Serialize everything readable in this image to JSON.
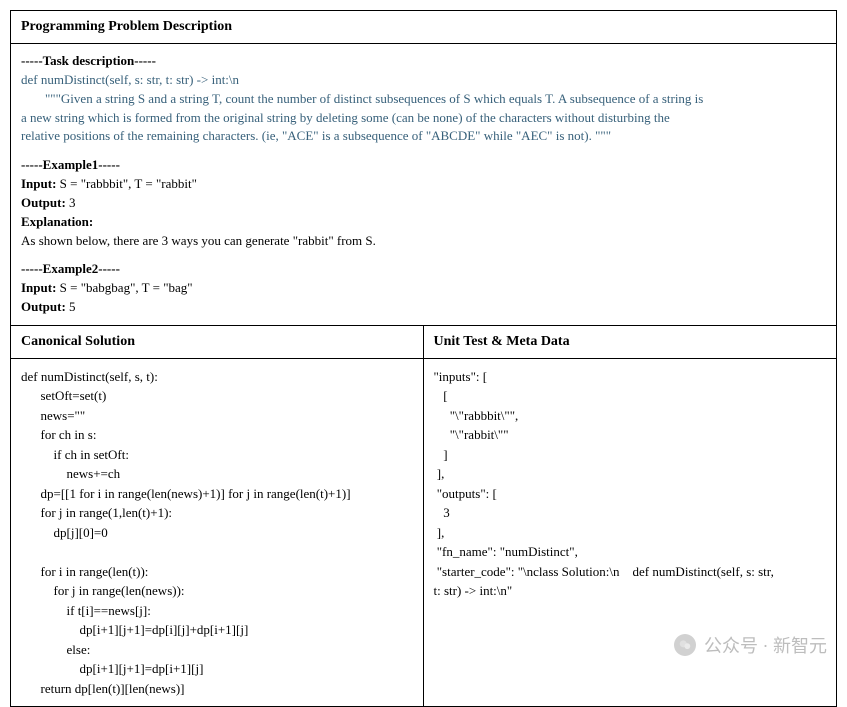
{
  "section_title": "Programming Problem Description",
  "task": {
    "label": "-----Task description-----",
    "signature": "def numDistinct(self, s: str, t: str) -> int:\\n",
    "doc1": "\"\"\"Given a string S and a string T, count the number of distinct subsequences of S which equals T. A subsequence of a string is",
    "doc2": "a new string which is formed from the original string by deleting some (can be none) of the characters without disturbing the",
    "doc3": "relative positions of the remaining characters. (ie, \"ACE\" is a subsequence of \"ABCDE\" while \"AEC\" is not). \"\"\""
  },
  "example1": {
    "label": "-----Example1-----",
    "input_label": "Input:",
    "input_text": " S = \"rabbbit\", T = \"rabbit\"",
    "output_label": "Output:",
    "output_text": " 3",
    "explanation_label": "Explanation:",
    "explanation_text": "As shown below, there are 3 ways you can generate \"rabbit\" from S."
  },
  "example2": {
    "label": "-----Example2-----",
    "input_label": "Input:",
    "input_text": " S = \"babgbag\", T = \"bag\"",
    "output_label": "Output:",
    "output_text": " 5"
  },
  "left": {
    "title": "Canonical Solution",
    "code": "def numDistinct(self, s, t):\n      setOft=set(t)\n      news=\"\"\n      for ch in s:\n          if ch in setOft:\n              news+=ch\n      dp=[[1 for i in range(len(news)+1)] for j in range(len(t)+1)]\n      for j in range(1,len(t)+1):\n          dp[j][0]=0\n\n      for i in range(len(t)):\n          for j in range(len(news)):\n              if t[i]==news[j]:\n                  dp[i+1][j+1]=dp[i][j]+dp[i+1][j]\n              else:\n                  dp[i+1][j+1]=dp[i+1][j]\n      return dp[len(t)][len(news)]"
  },
  "right": {
    "title": "Unit Test & Meta Data",
    "code": "\"inputs\": [\n   [\n     \"\\\"rabbbit\\\"\",\n     \"\\\"rabbit\\\"\"\n   ]\n ],\n \"outputs\": [\n   3\n ],\n \"fn_name\": \"numDistinct\",\n \"starter_code\": \"\\nclass Solution:\\n    def numDistinct(self, s: str,\nt: str) -> int:\\n\""
  },
  "watermark": "公众号 · 新智元"
}
